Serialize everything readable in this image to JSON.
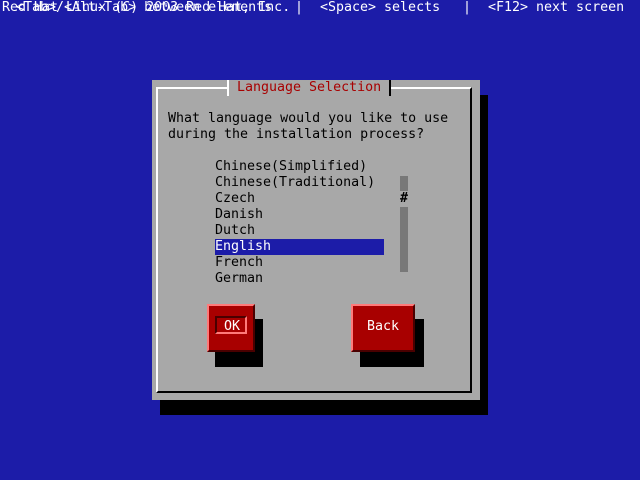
{
  "header": {
    "text": "Red Hat Linux (C) 2003 Red Hat, Inc."
  },
  "dialog": {
    "title": "Language Selection",
    "prompt_line1": "What language would you like to use",
    "prompt_line2": "during the installation process?",
    "languages": [
      "Chinese(Simplified)",
      "Chinese(Traditional)",
      "Czech",
      "Danish",
      "Dutch",
      "English",
      "French",
      "German"
    ],
    "selected_language": "English",
    "scroll_thumb_glyph": "#",
    "buttons": {
      "ok": "OK",
      "back": "Back"
    }
  },
  "footer": {
    "hint_tab": "<Tab>/<Alt-Tab> between elements",
    "sep1": "|",
    "hint_space": "<Space> selects",
    "sep2": "|",
    "hint_f12": "<F12> next screen"
  },
  "colors": {
    "background": "#1c1ca8",
    "dialog": "#a8a8a8",
    "title_text": "#a80000",
    "button": "#a80000",
    "selection": "#1c1ca8"
  }
}
